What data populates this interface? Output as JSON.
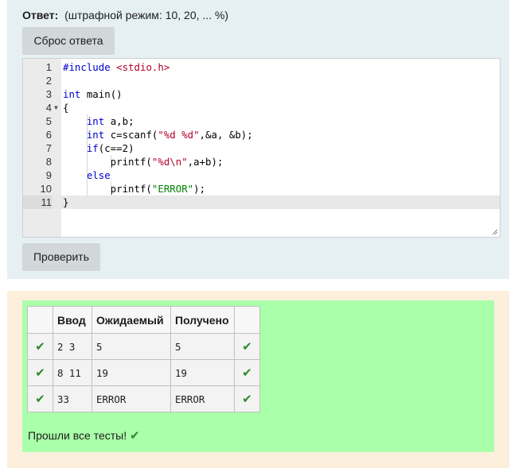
{
  "answer": {
    "label": "Ответ:",
    "penalty_note": "(штрафной режим: 10, 20, ... %)",
    "reset_button": "Сброс ответа",
    "check_button": "Проверить"
  },
  "editor": {
    "lines": [
      {
        "n": "1",
        "tokens": [
          {
            "t": "#include ",
            "c": "kw"
          },
          {
            "t": "<stdio.h>",
            "c": "inc"
          }
        ]
      },
      {
        "n": "2",
        "tokens": []
      },
      {
        "n": "3",
        "tokens": [
          {
            "t": "int",
            "c": "kw"
          },
          {
            "t": " main()",
            "c": ""
          }
        ]
      },
      {
        "n": "4",
        "tokens": [
          {
            "t": "{",
            "c": ""
          }
        ]
      },
      {
        "n": "5",
        "tokens": [
          {
            "t": "    ",
            "c": ""
          },
          {
            "t": "int",
            "c": "kw"
          },
          {
            "t": " a,b;",
            "c": ""
          }
        ]
      },
      {
        "n": "6",
        "tokens": [
          {
            "t": "    ",
            "c": ""
          },
          {
            "t": "int",
            "c": "kw"
          },
          {
            "t": " c=scanf(",
            "c": ""
          },
          {
            "t": "\"%d %d\"",
            "c": "str"
          },
          {
            "t": ",&a, &b);",
            "c": ""
          }
        ]
      },
      {
        "n": "7",
        "tokens": [
          {
            "t": "    ",
            "c": ""
          },
          {
            "t": "if",
            "c": "kw"
          },
          {
            "t": "(c==2)",
            "c": ""
          }
        ]
      },
      {
        "n": "8",
        "tokens": [
          {
            "t": "        printf(",
            "c": ""
          },
          {
            "t": "\"%d\\n\"",
            "c": "str"
          },
          {
            "t": ",a+b);",
            "c": ""
          }
        ]
      },
      {
        "n": "9",
        "tokens": [
          {
            "t": "    ",
            "c": ""
          },
          {
            "t": "else",
            "c": "kw"
          }
        ]
      },
      {
        "n": "10",
        "tokens": [
          {
            "t": "        printf(",
            "c": ""
          },
          {
            "t": "\"ERROR\"",
            "c": "str2"
          },
          {
            "t": ");",
            "c": ""
          }
        ]
      },
      {
        "n": "11",
        "tokens": [
          {
            "t": "}",
            "c": ""
          }
        ]
      }
    ],
    "fold_marker_line": "4",
    "fold_icon": "triangle-down",
    "active_line": "11"
  },
  "results": {
    "headers": [
      "",
      "Ввод",
      "Ожидаемый",
      "Получено",
      ""
    ],
    "rows": [
      {
        "input": "2 3",
        "expected": "5",
        "got": "5"
      },
      {
        "input": "8 11",
        "expected": "19",
        "got": "19"
      },
      {
        "input": "33",
        "expected": "ERROR",
        "got": "ERROR"
      }
    ],
    "check_icon": "check-mark",
    "summary": "Прошли все тесты!"
  },
  "colors": {
    "answer_bg": "#e6eff2",
    "result_outer_bg": "#fcefdc",
    "result_inner_bg": "#aaffaa",
    "check_green": "#2c8a2c",
    "keyword_blue": "#0000cc",
    "string_red": "#b5002a",
    "string_green": "#008000"
  }
}
